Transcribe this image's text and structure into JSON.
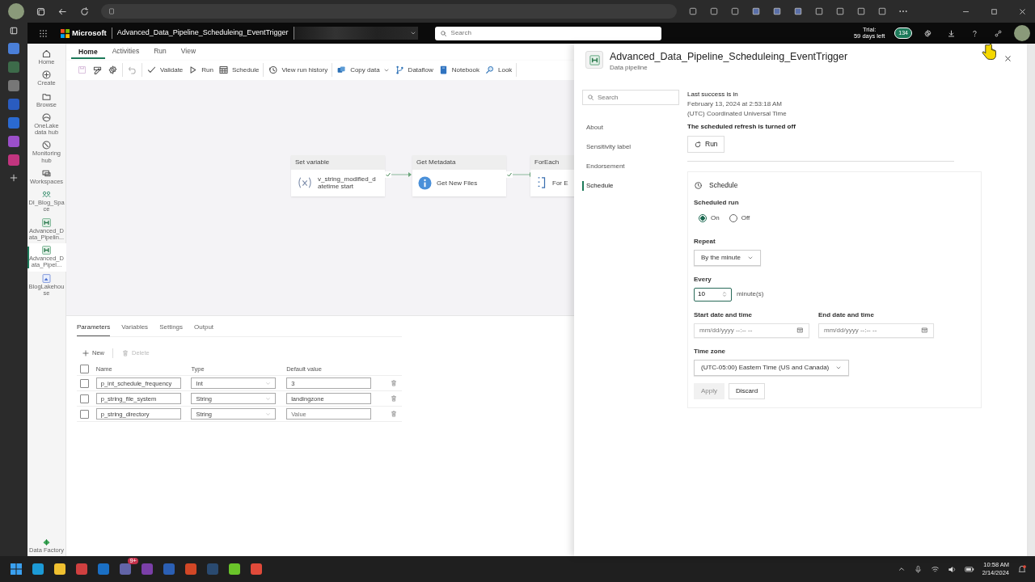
{
  "header": {
    "brand": "Microsoft",
    "item_title": "Advanced_Data_Pipeline_Scheduleing_EventTrigger",
    "search": {
      "placeholder": "Search"
    },
    "trial_label": "Trial:",
    "trial_days": "59 days left",
    "notification_count": "134"
  },
  "rail": {
    "items": [
      {
        "kind": "home",
        "label": "Home",
        "selected": false
      },
      {
        "kind": "create",
        "label": "Create",
        "selected": false
      },
      {
        "kind": "browse",
        "label": "Browse",
        "selected": false
      },
      {
        "kind": "onelake",
        "label": "OneLake data hub",
        "selected": false
      },
      {
        "kind": "monitor",
        "label": "Monitoring hub",
        "selected": false
      },
      {
        "kind": "workspaces",
        "label": "Workspaces",
        "selected": false
      },
      {
        "kind": "workspace",
        "label": "DI_Blog_Space",
        "selected": false
      },
      {
        "kind": "pipeline",
        "label": "Advanced_Data_Pipelin...",
        "selected": false
      },
      {
        "kind": "pipeline",
        "label": "Advanced_Data_Pipel...",
        "selected": true
      },
      {
        "kind": "lakehouse",
        "label": "BlogLakehouse",
        "selected": false
      }
    ],
    "footer": "Data Factory"
  },
  "menu_tabs": [
    {
      "label": "Home",
      "selected": true
    },
    {
      "label": "Activities",
      "selected": false
    },
    {
      "label": "Run",
      "selected": false
    },
    {
      "label": "View",
      "selected": false
    }
  ],
  "toolbar": {
    "groups": [
      [
        {
          "kind": "save",
          "disabled": true
        },
        {
          "kind": "edit",
          "disabled": false
        },
        {
          "kind": "settings",
          "disabled": false
        }
      ],
      [
        {
          "kind": "undo",
          "disabled": true
        }
      ],
      [
        {
          "kind": "validate",
          "label": "Validate",
          "disabled": false
        },
        {
          "kind": "run",
          "label": "Run",
          "disabled": false
        },
        {
          "kind": "schedule",
          "label": "Schedule",
          "disabled": false
        }
      ],
      [
        {
          "kind": "history",
          "label": "View run history",
          "disabled": false
        }
      ],
      [
        {
          "kind": "copy",
          "label": "Copy data",
          "dropdown": true,
          "disabled": false
        },
        {
          "kind": "dataflow",
          "label": "Dataflow",
          "disabled": false
        },
        {
          "kind": "notebook",
          "label": "Notebook",
          "disabled": false
        },
        {
          "kind": "lookup",
          "label": "Look",
          "disabled": false
        }
      ]
    ]
  },
  "canvas": {
    "activities": [
      {
        "kind": "variable",
        "type": "Set variable",
        "name": "v_string_modified_datetime start"
      },
      {
        "kind": "metadata",
        "type": "Get Metadata",
        "name": "Get New Files"
      },
      {
        "kind": "foreach",
        "type": "ForEach",
        "name": "For E"
      }
    ]
  },
  "bottom_panel": {
    "tabs": [
      {
        "label": "Parameters",
        "selected": true
      },
      {
        "label": "Variables",
        "selected": false
      },
      {
        "label": "Settings",
        "selected": false
      },
      {
        "label": "Output",
        "selected": false
      }
    ],
    "actions": [
      {
        "kind": "new",
        "label": "New",
        "disabled": false
      },
      {
        "kind": "delete",
        "label": "Delete",
        "disabled": true
      }
    ],
    "table": {
      "columns": [
        "Name",
        "Type",
        "Default value"
      ],
      "all_checked": false,
      "rows": [
        {
          "checked": false,
          "name": "p_int_schedule_frequency",
          "type": "Int",
          "default_value": "3"
        },
        {
          "checked": false,
          "name": "p_string_file_system",
          "type": "String",
          "default_value": "landingzone"
        },
        {
          "checked": false,
          "name": "p_string_directory",
          "type": "String",
          "placeholder": "Value"
        }
      ]
    }
  },
  "settings_panel": {
    "title": "Advanced_Data_Pipeline_Scheduleing_EventTrigger",
    "subtitle": "Data pipeline",
    "search": {
      "placeholder": "Search"
    },
    "nav": [
      {
        "label": "About",
        "selected": false
      },
      {
        "label": "Sensitivity label",
        "selected": false
      },
      {
        "label": "Endorsement",
        "selected": false
      },
      {
        "label": "Schedule",
        "selected": true
      }
    ],
    "last_success_label": "Last success is in",
    "last_success_time": "February 13, 2024 at 2:53:18 AM",
    "time_zone_note": "(UTC) Coordinated Universal Time",
    "refresh_status": "The scheduled refresh is turned off",
    "run_button": "Run",
    "schedule": {
      "heading": "Schedule",
      "scheduled_run_label": "Scheduled run",
      "options": [
        {
          "label": "On",
          "selected": true
        },
        {
          "label": "Off",
          "selected": false
        }
      ],
      "repeat_label": "Repeat",
      "repeat_value": "By the minute",
      "every_label": "Every",
      "every_value": "10",
      "every_unit": "minute(s)",
      "start_label": "Start date and time",
      "start_placeholder": "mm/dd/yyyy --:-- --",
      "end_label": "End date and time",
      "end_placeholder": "mm/dd/yyyy --:-- --",
      "time_zone_label": "Time zone",
      "time_zone_value": "(UTC-05:00) Eastern Time (US and Canada)",
      "buttons": [
        {
          "label": "Apply",
          "disabled": true
        },
        {
          "label": "Discard",
          "disabled": false
        }
      ]
    }
  },
  "taskbar": {
    "chat_badge": "9+",
    "time": "10:58 AM",
    "date": "2/14/2024"
  }
}
